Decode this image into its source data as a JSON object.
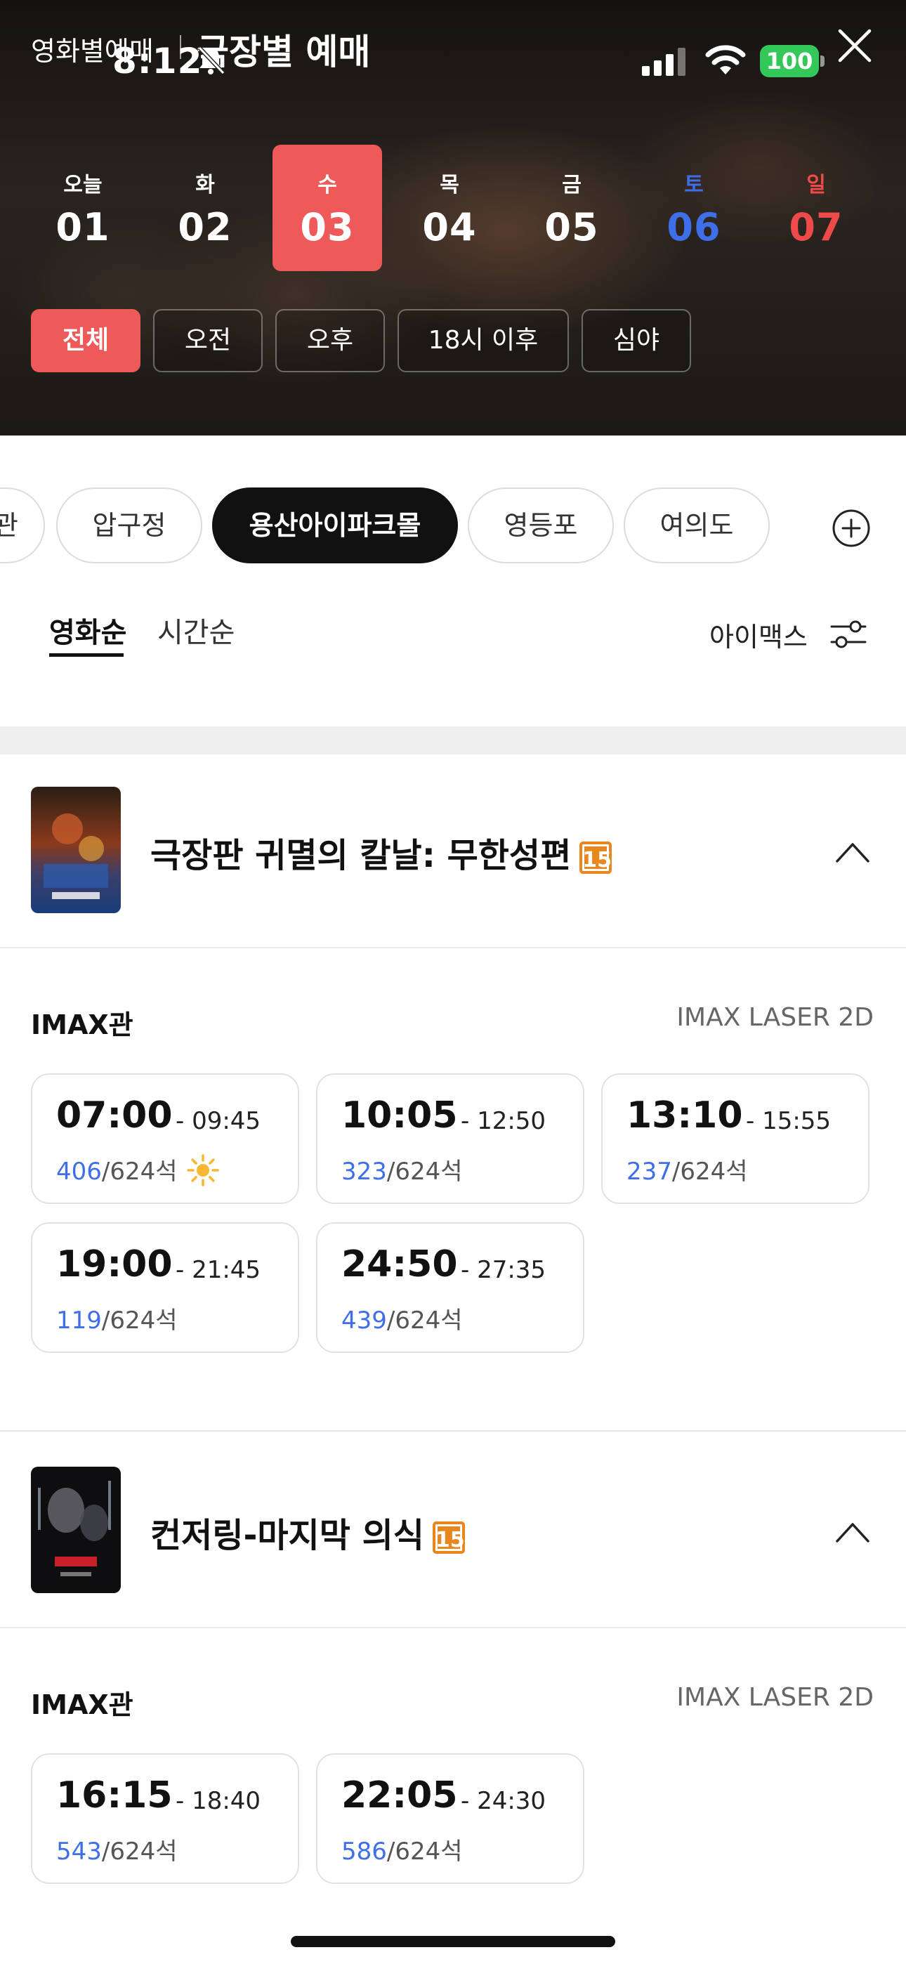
{
  "status_bar": {
    "time": "8:12",
    "battery": "100"
  },
  "header": {
    "tab_by_movie": "영화별예매",
    "tab_by_theater": "극장별 예매"
  },
  "dates": [
    {
      "dow": "오늘",
      "num": "01",
      "kind": "normal",
      "selected": false
    },
    {
      "dow": "화",
      "num": "02",
      "kind": "normal",
      "selected": false
    },
    {
      "dow": "수",
      "num": "03",
      "kind": "normal",
      "selected": true
    },
    {
      "dow": "목",
      "num": "04",
      "kind": "normal",
      "selected": false
    },
    {
      "dow": "금",
      "num": "05",
      "kind": "normal",
      "selected": false
    },
    {
      "dow": "토",
      "num": "06",
      "kind": "sat",
      "selected": false
    },
    {
      "dow": "일",
      "num": "07",
      "kind": "sun",
      "selected": false
    }
  ],
  "time_filters": [
    "전체",
    "오전",
    "오후",
    "18시 이후",
    "심야"
  ],
  "theaters": [
    "관",
    "압구정",
    "용산아이파크몰",
    "영등포",
    "여의도"
  ],
  "sort": {
    "by_movie": "영화순",
    "by_time": "시간순",
    "filter_label": "아이맥스"
  },
  "movies": [
    {
      "title": "극장판 귀멸의 칼날: 무한성편",
      "age": "15",
      "hall": "IMAX관",
      "format": "IMAX LASER 2D",
      "showtimes": [
        {
          "start": "07:00",
          "end": "- 09:45",
          "available": "406",
          "total": "/624석",
          "morning": true
        },
        {
          "start": "10:05",
          "end": "- 12:50",
          "available": "323",
          "total": "/624석",
          "morning": false
        },
        {
          "start": "13:10",
          "end": "- 15:55",
          "available": "237",
          "total": "/624석",
          "morning": false
        },
        {
          "start": "19:00",
          "end": "- 21:45",
          "available": "119",
          "total": "/624석",
          "morning": false
        },
        {
          "start": "24:50",
          "end": "- 27:35",
          "available": "439",
          "total": "/624석",
          "morning": false
        }
      ]
    },
    {
      "title": "컨저링-마지막 의식",
      "age": "15",
      "hall": "IMAX관",
      "format": "IMAX LASER 2D",
      "showtimes": [
        {
          "start": "16:15",
          "end": "- 18:40",
          "available": "543",
          "total": "/624석",
          "morning": false
        },
        {
          "start": "22:05",
          "end": "- 24:30",
          "available": "586",
          "total": "/624석",
          "morning": false
        }
      ]
    }
  ],
  "colors": {
    "accent": "#ee5a5a",
    "saturday": "#3f6fe8",
    "sunday": "#ef4a4a",
    "seats_available": "#3f6fe8",
    "age_badge": "#e8871e"
  }
}
